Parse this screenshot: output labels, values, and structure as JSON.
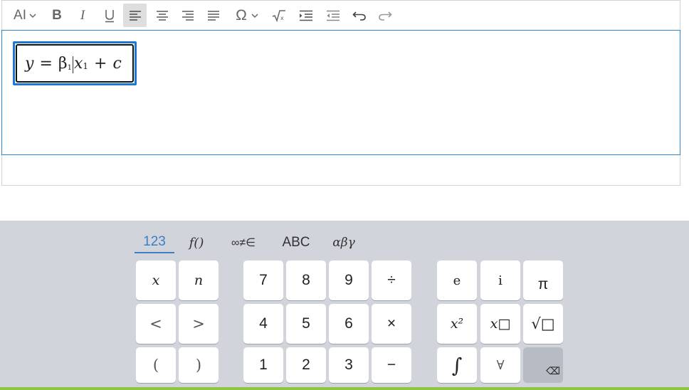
{
  "toolbar": {
    "font_size_label": "AI",
    "items": [
      {
        "name": "font-size-button",
        "icon": "font-size-icon"
      },
      {
        "name": "bold-button",
        "icon": "bold-icon",
        "label": "B"
      },
      {
        "name": "italic-button",
        "icon": "italic-icon",
        "label": "I"
      },
      {
        "name": "underline-button",
        "icon": "underline-icon",
        "label": "U"
      },
      {
        "name": "align-left-button",
        "icon": "align-left-icon",
        "active": true
      },
      {
        "name": "align-center-button",
        "icon": "align-center-icon"
      },
      {
        "name": "align-right-button",
        "icon": "align-right-icon"
      },
      {
        "name": "justify-button",
        "icon": "justify-icon"
      },
      {
        "name": "special-char-button",
        "icon": "omega-icon",
        "label": "Ω"
      },
      {
        "name": "equation-button",
        "icon": "sqrt-icon"
      },
      {
        "name": "indent-button",
        "icon": "indent-icon"
      },
      {
        "name": "outdent-button",
        "icon": "outdent-icon"
      },
      {
        "name": "undo-button",
        "icon": "undo-icon"
      },
      {
        "name": "redo-button",
        "icon": "redo-icon"
      }
    ]
  },
  "editor": {
    "equation": {
      "y": "y",
      "equals": "=",
      "beta": "β",
      "beta_sub": "1",
      "x": "x",
      "x_sub": "1",
      "plus": "+",
      "c": "c"
    }
  },
  "keyboard": {
    "tabs": [
      "123",
      "f()",
      "∞≠∈",
      "ABC",
      "αβγ"
    ],
    "active_tab": "123",
    "rows": [
      [
        "x",
        "n",
        "7",
        "8",
        "9",
        "÷",
        "e",
        "i",
        "π"
      ],
      [
        "<",
        ">",
        "4",
        "5",
        "6",
        "×",
        "x²",
        "x□",
        "√□"
      ],
      [
        "(",
        ")",
        "1",
        "2",
        "3",
        "−",
        "∫",
        "∀",
        "⌫"
      ]
    ],
    "accent_color": "#3b7fc4"
  }
}
